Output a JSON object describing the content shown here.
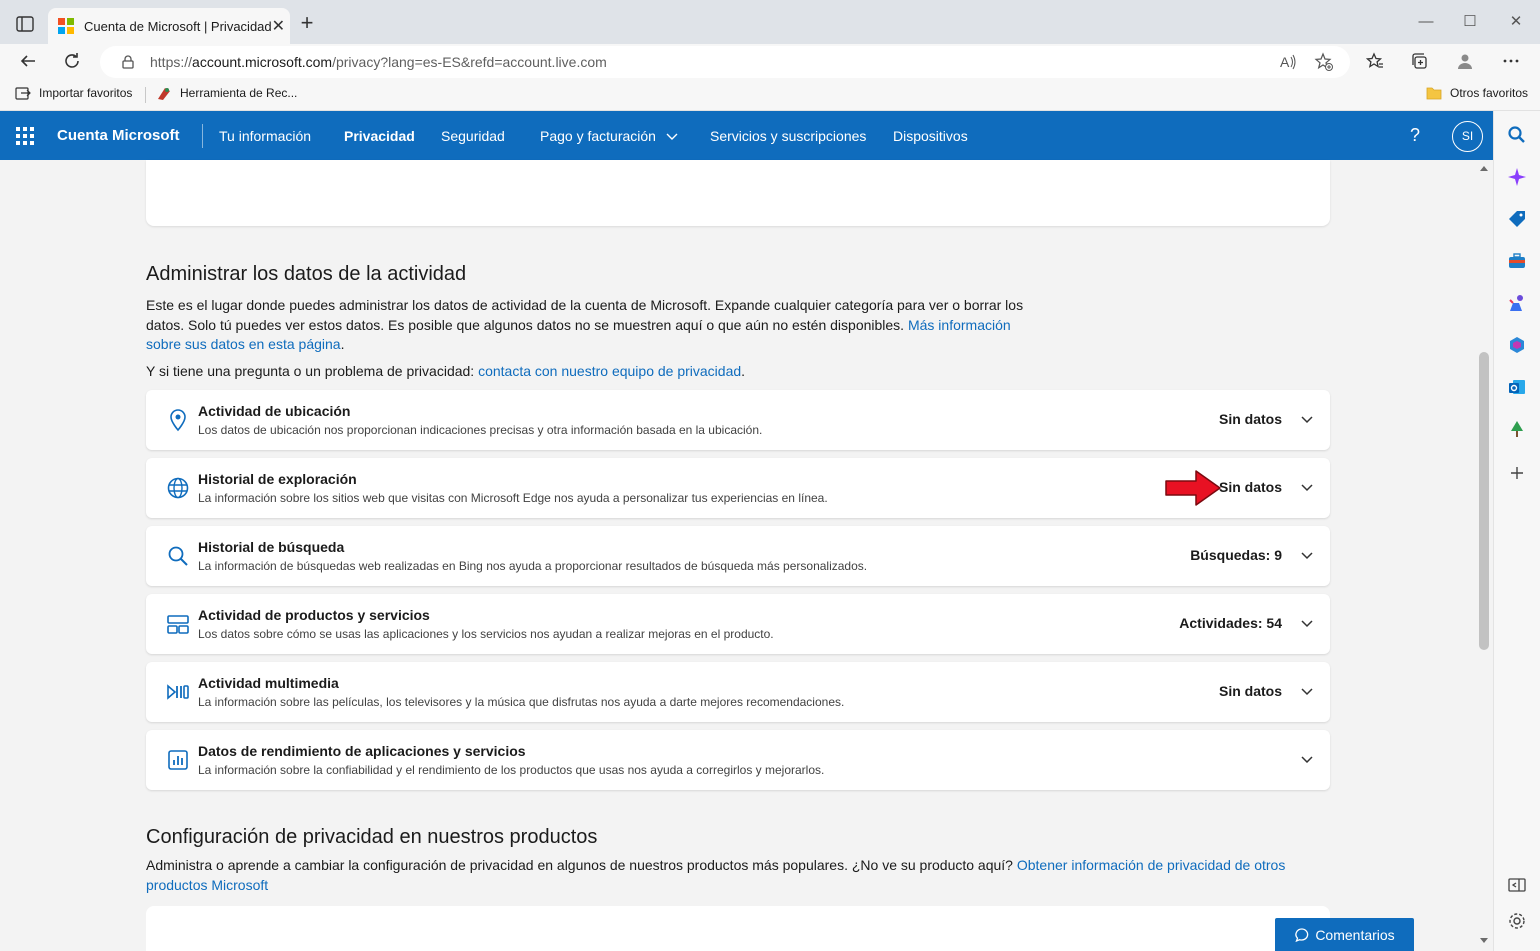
{
  "browser": {
    "tab_title": "Cuenta de Microsoft | Privacidad",
    "url_prefix": "https://",
    "url_domain": "account.microsoft.com",
    "url_path": "/privacy?lang=es-ES&refd=account.live.com",
    "favorites": [
      {
        "label": "Importar favoritos",
        "icon": "import-favorites-icon"
      },
      {
        "label": "Herramienta de Rec...",
        "icon": "tool-favicon"
      }
    ],
    "other_favorites": "Otros favoritos"
  },
  "header": {
    "brand": "Cuenta Microsoft",
    "nav": [
      {
        "label": "Tu información"
      },
      {
        "label": "Privacidad",
        "active": true
      },
      {
        "label": "Seguridad"
      },
      {
        "label": "Pago y facturación"
      },
      {
        "label": "Servicios y suscripciones"
      },
      {
        "label": "Dispositivos"
      }
    ],
    "help": "?",
    "avatar_initials": "SI"
  },
  "section_activity": {
    "title": "Administrar los datos de la actividad",
    "description": "Este es el lugar donde puedes administrar los datos de actividad de la cuenta de Microsoft. Expande cualquier categoría para ver o borrar los datos. Solo tú puedes ver estos datos. Es posible que algunos datos no se muestren aquí o que aún no estén disponibles.",
    "more_info_link": "Más información sobre sus datos en esta página",
    "question_text": "Y si tiene una pregunta o un problema de privacidad:",
    "question_link": "contacta con nuestro equipo de privacidad",
    "rows": [
      {
        "title": "Actividad de ubicación",
        "description": "Los datos de ubicación nos proporcionan indicaciones precisas y otra información basada en la ubicación.",
        "status": "Sin datos",
        "icon": "location-pin-icon"
      },
      {
        "title": "Historial de exploración",
        "description": "La información sobre los sitios web que visitas con Microsoft Edge nos ayuda a personalizar tus experiencias en línea.",
        "status": "Sin datos",
        "icon": "globe-icon"
      },
      {
        "title": "Historial de búsqueda",
        "description": "La información de búsquedas web realizadas en Bing nos ayuda a proporcionar resultados de búsqueda más personalizados.",
        "status": "Búsquedas: 9",
        "icon": "search-icon"
      },
      {
        "title": "Actividad de productos y servicios",
        "description": "Los datos sobre cómo se usas las aplicaciones y los servicios nos ayudan a realizar mejoras en el producto.",
        "status": "Actividades: 54",
        "icon": "apps-icon"
      },
      {
        "title": "Actividad multimedia",
        "description": "La información sobre las películas, los televisores y la música que disfrutas nos ayuda a darte mejores recomendaciones.",
        "status": "Sin datos",
        "icon": "media-icon"
      },
      {
        "title": "Datos de rendimiento de aplicaciones y servicios",
        "description": "La información sobre la confiabilidad y el rendimiento de los productos que usas nos ayuda a corregirlos y mejorarlos.",
        "status": "",
        "icon": "chart-icon"
      }
    ]
  },
  "section_privacy_settings": {
    "title": "Configuración de privacidad en nuestros productos",
    "description": "Administra o aprende a cambiar la configuración de privacidad en algunos de nuestros productos más populares. ¿No ve su producto aquí?",
    "link": "Obtener información de privacidad de otros productos Microsoft"
  },
  "feedback_button": "Comentarios",
  "colors": {
    "accent": "#0f6cbd",
    "annotation_arrow": "#e81123"
  }
}
